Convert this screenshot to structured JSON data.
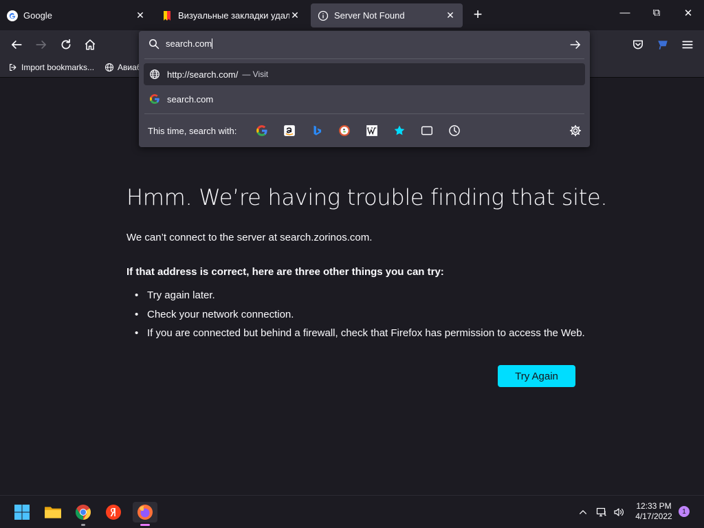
{
  "tabs": [
    {
      "title": "Google",
      "favicon": "google-g-icon",
      "active": false
    },
    {
      "title": "Визуальные закладки удалены",
      "favicon": "yandex-bookmark-icon",
      "active": false
    },
    {
      "title": "Server Not Found",
      "favicon": "info-icon",
      "active": true
    }
  ],
  "close_glyph": "✕",
  "newtab_glyph": "+",
  "window_controls": {
    "minimize": "—",
    "maximize": "⧉",
    "close": "✕"
  },
  "bookmarks": [
    {
      "label": "Import bookmarks...",
      "icon": "import-icon"
    },
    {
      "label": "Авиаб",
      "icon": "globe-icon"
    }
  ],
  "urlbar": {
    "value": "search.com",
    "results": [
      {
        "text": "http://search.com/",
        "sub": "— Visit",
        "icon": "globe-icon",
        "highlighted": true
      },
      {
        "text": "search.com",
        "sub": "",
        "icon": "google-g-icon",
        "highlighted": false
      }
    ],
    "search_with_label": "This time, search with:",
    "engines": [
      "google-icon",
      "amazon-icon",
      "bing-icon",
      "duckduckgo-icon",
      "wikipedia-icon",
      "bookmarks-star-icon",
      "tabs-icon",
      "history-icon"
    ]
  },
  "error": {
    "title": "Hmm. We’re having trouble finding that site.",
    "description": "We can’t connect to the server at search.zorinos.com.",
    "suggestion_heading": "If that address is correct, here are three other things you can try:",
    "suggestions": [
      "Try again later.",
      "Check your network connection.",
      "If you are connected but behind a firewall, check that Firefox has permission to access the Web."
    ],
    "button_label": "Try Again"
  },
  "taskbar": {
    "apps": [
      "windows-start-icon",
      "file-explorer-icon",
      "chrome-icon",
      "yandex-browser-icon",
      "firefox-icon"
    ],
    "time": "12:33 PM",
    "date": "4/17/2022",
    "notification_count": "1"
  },
  "colors": {
    "accent": "#00ddff",
    "background": "#1c1b22",
    "toolbar": "#2b2a33",
    "panel": "#42414d"
  }
}
